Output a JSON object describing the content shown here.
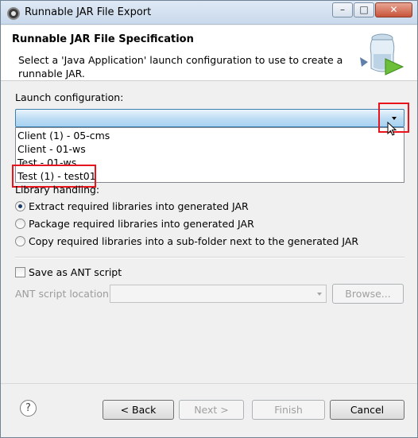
{
  "window": {
    "title": "Runnable JAR File Export",
    "controls": {
      "minimize": "–",
      "maximize": "□",
      "close": "✕"
    }
  },
  "header": {
    "title": "Runnable JAR File Specification",
    "description": "Select a 'Java Application' launch configuration to use to create a runnable JAR.",
    "icon": "jar-export-icon"
  },
  "launch": {
    "label": "Launch configuration:",
    "selected_value": "",
    "options": [
      "Client (1) - 05-cms",
      "Client - 01-ws",
      "Test - 01-ws",
      "Test (1) - test01"
    ]
  },
  "library": {
    "label": "Library handling:",
    "options": [
      {
        "label": "Extract required libraries into generated JAR",
        "checked": true
      },
      {
        "label": "Package required libraries into generated JAR",
        "checked": false
      },
      {
        "label": "Copy required libraries into a sub-folder next to the generated JAR",
        "checked": false
      }
    ]
  },
  "ant": {
    "save_label": "Save as ANT script",
    "save_checked": false,
    "location_label": "ANT script location:",
    "location_value": "",
    "browse_label": "Browse..."
  },
  "footer": {
    "help": "?",
    "back": "< Back",
    "next": "Next >",
    "finish": "Finish",
    "cancel": "Cancel"
  },
  "colors": {
    "highlight": "#e8131b",
    "combo_focus": "#3c7fb1"
  }
}
